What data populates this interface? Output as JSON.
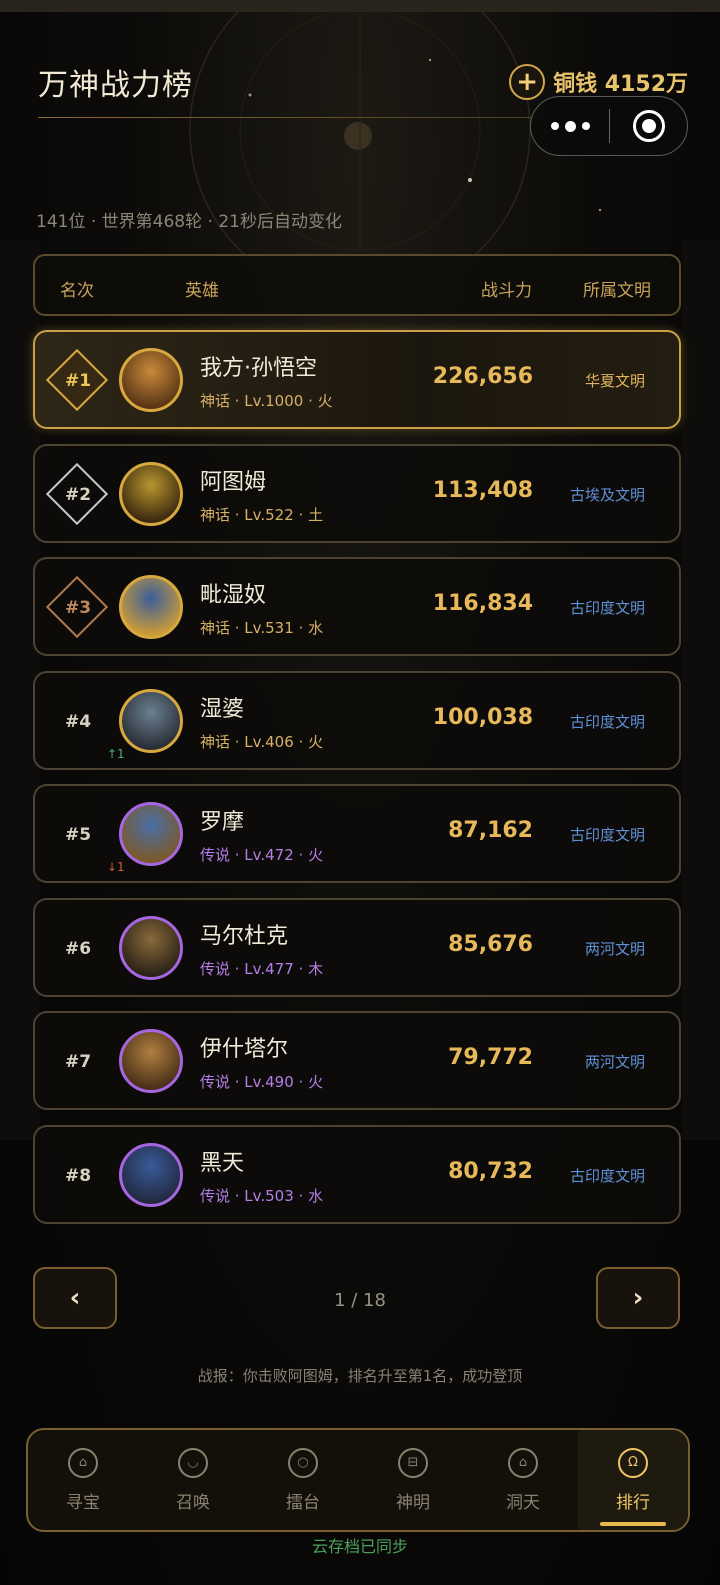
{
  "header": {
    "title": "万神战力榜",
    "coins_label": "铜钱 4152万",
    "subinfo": "141位 · 世界第468轮 · 21秒后自动变化"
  },
  "table_header": {
    "rank": "名次",
    "hero": "英雄",
    "power": "战斗力",
    "civ": "所属文明"
  },
  "heroes": [
    {
      "rank": "#1",
      "name": "我方·孙悟空",
      "meta": "神话 · Lv.1000 · 火",
      "power": "226,656",
      "civ": "华夏文明",
      "tier": "myth",
      "delta": ""
    },
    {
      "rank": "#2",
      "name": "阿图姆",
      "meta": "神话 · Lv.522 · 土",
      "power": "113,408",
      "civ": "古埃及文明",
      "tier": "myth",
      "delta": ""
    },
    {
      "rank": "#3",
      "name": "毗湿奴",
      "meta": "神话 · Lv.531 · 水",
      "power": "116,834",
      "civ": "古印度文明",
      "tier": "myth",
      "delta": ""
    },
    {
      "rank": "#4",
      "name": "湿婆",
      "meta": "神话 · Lv.406 · 火",
      "power": "100,038",
      "civ": "古印度文明",
      "tier": "myth",
      "delta": "↑1"
    },
    {
      "rank": "#5",
      "name": "罗摩",
      "meta": "传说 · Lv.472 · 火",
      "power": "87,162",
      "civ": "古印度文明",
      "tier": "legend",
      "delta": "↓1"
    },
    {
      "rank": "#6",
      "name": "马尔杜克",
      "meta": "传说 · Lv.477 · 木",
      "power": "85,676",
      "civ": "两河文明",
      "tier": "legend",
      "delta": ""
    },
    {
      "rank": "#7",
      "name": "伊什塔尔",
      "meta": "传说 · Lv.490 · 火",
      "power": "79,772",
      "civ": "两河文明",
      "tier": "legend",
      "delta": ""
    },
    {
      "rank": "#8",
      "name": "黑天",
      "meta": "传说 · Lv.503 · 水",
      "power": "80,732",
      "civ": "古印度文明",
      "tier": "legend",
      "delta": ""
    }
  ],
  "pagination": {
    "prev": "‹",
    "next": "›",
    "text": "1 / 18"
  },
  "report": "战报：你击败阿图姆，排名升至第1名，成功登顶",
  "tabs": [
    {
      "label": "寻宝",
      "icon": "treasure-icon"
    },
    {
      "label": "召唤",
      "icon": "summon-icon"
    },
    {
      "label": "擂台",
      "icon": "arena-icon"
    },
    {
      "label": "神明",
      "icon": "deity-icon"
    },
    {
      "label": "洞天",
      "icon": "home-icon"
    },
    {
      "label": "排行",
      "icon": "ranking-icon"
    }
  ],
  "sync": "云存档已同步",
  "colors": {
    "gold": "#e8b95a",
    "civ_blue": "#5f8fd6",
    "legend_purple": "#b47ee8",
    "up": "#4caf7a",
    "down": "#d05a3c"
  }
}
